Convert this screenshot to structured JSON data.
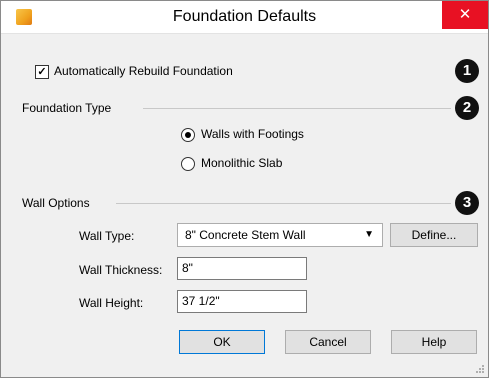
{
  "window": {
    "title": "Foundation Defaults",
    "close_label": "✕"
  },
  "auto_rebuild": {
    "label": "Automatically Rebuild Foundation",
    "checked": true,
    "badge": "1"
  },
  "foundation_type": {
    "heading": "Foundation Type",
    "badge": "2",
    "options": [
      {
        "label": "Walls with Footings",
        "selected": true
      },
      {
        "label": "Monolithic Slab",
        "selected": false
      }
    ]
  },
  "wall_options": {
    "heading": "Wall Options",
    "badge": "3",
    "wall_type_label": "Wall Type:",
    "wall_type_value": "8\" Concrete Stem Wall",
    "define_label": "Define...",
    "wall_thickness_label": "Wall Thickness:",
    "wall_thickness_value": "8\"",
    "wall_height_label": "Wall Height:",
    "wall_height_value": "37 1/2\""
  },
  "buttons": {
    "ok": "OK",
    "cancel": "Cancel",
    "help": "Help"
  }
}
